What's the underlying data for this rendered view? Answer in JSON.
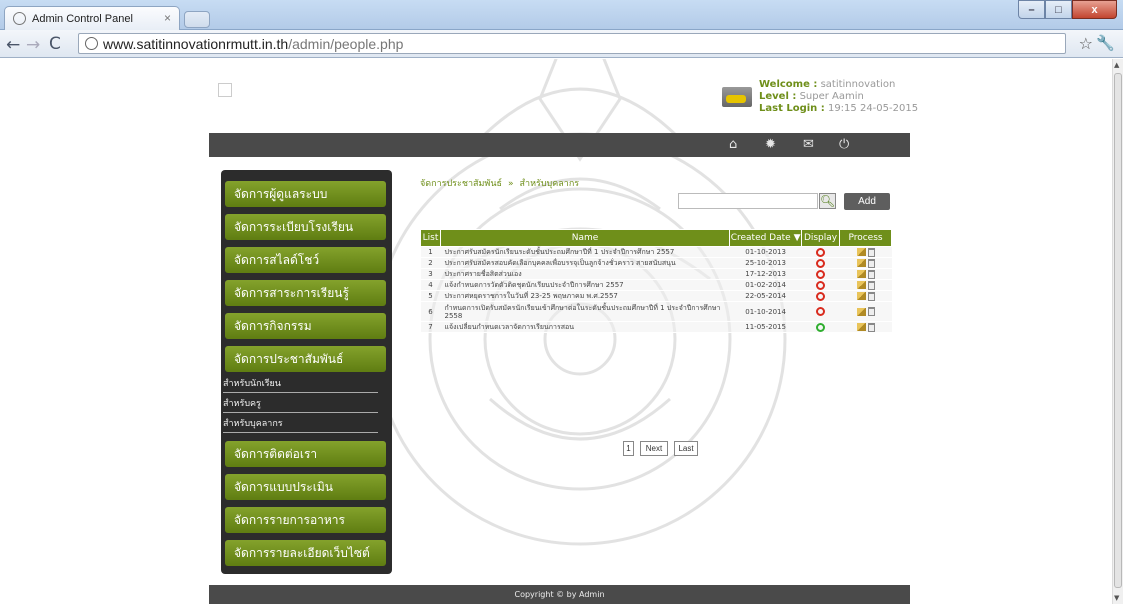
{
  "browser": {
    "tab_title": "Admin Control Panel",
    "tab_close": "×",
    "url_host": "www.satitinnovationrmutt.in.th",
    "url_path": "/admin/people.php",
    "window_buttons": {
      "minimize": "–",
      "maximize": "□",
      "close": "x"
    }
  },
  "user": {
    "welcome_label": "Welcome :",
    "welcome_value": "satitinnovation",
    "level_label": "Level :",
    "level_value": "Super Aamin",
    "login_label": "Last Login :",
    "login_value": "19:15 24-05-2015"
  },
  "topbar_icons": [
    "home-icon",
    "settings-icon",
    "mail-icon",
    "power-icon"
  ],
  "sidebar": {
    "items": [
      "จัดการผู้ดูแลระบบ",
      "จัดการระเบียบโรงเรียน",
      "จัดการสไลด์โชว์",
      "จัดการสาระการเรียนรู้",
      "จัดการกิจกรรม",
      "จัดการประชาสัมพันธ์",
      "จัดการติดต่อเรา",
      "จัดการแบบประเมิน",
      "จัดการรายการอาหาร",
      "จัดการรายละเอียดเว็บไซต์"
    ],
    "subitems": [
      "สำหรับนักเรียน",
      "สำหรับครู",
      "สำหรับบุคลากร"
    ]
  },
  "breadcrumb": {
    "parent": "จัดการประชาสัมพันธ์",
    "sep": "»",
    "current": "สำหรับบุคลากร"
  },
  "search": {
    "placeholder": "",
    "add_label": "Add"
  },
  "table": {
    "headers": {
      "list": "List",
      "name": "Name",
      "created": "Created Date",
      "sort_arrow": "▼",
      "display": "Display",
      "process": "Process"
    },
    "rows": [
      {
        "no": "1",
        "name": "ประกาศรับสมัครนักเรียนระดับชั้นประถมศึกษาปีที่ 1 ประจำปีการศึกษา 2557",
        "date": "01-10-2013",
        "display": "off"
      },
      {
        "no": "2",
        "name": "ประกาศรับสมัครสอบคัดเลือกบุคคลเพื่อบรรจุเป็นลูกจ้างชั่วคราว สายสนับสนุน",
        "date": "25-10-2013",
        "display": "off"
      },
      {
        "no": "3",
        "name": "ประกาศรายชื่อสิตส่วนเอง",
        "date": "17-12-2013",
        "display": "off"
      },
      {
        "no": "4",
        "name": "แจ้งกำหนดการวัดตัวติดชุดนักเรียนประจำปีการศึกษา 2557",
        "date": "01-02-2014",
        "display": "off"
      },
      {
        "no": "5",
        "name": "ประกาศหยุดราชการในวันที่ 23-25 พฤษภาคม พ.ศ.2557",
        "date": "22-05-2014",
        "display": "off"
      },
      {
        "no": "6",
        "name": "กำหนดการเปิดรับสมัครนักเรียนเข้าศึกษาต่อในระดับชั้นประถมศึกษาปีที่ 1 ประจำปีการศึกษา 2558",
        "date": "01-10-2014",
        "display": "off"
      },
      {
        "no": "7",
        "name": "แจ้งเปลี่ยนกำหนดเวลาจัดการเรียนการสอน",
        "date": "11-05-2015",
        "display": "on"
      }
    ]
  },
  "pagination": {
    "page": "1",
    "next": "Next",
    "last": "Last"
  },
  "footer": {
    "text": "Copyright © by Admin"
  },
  "colors": {
    "accent_green": "#6f8f1a",
    "dark_bar": "#4a4a4a",
    "sidebar_bg": "#2c2c2c",
    "display_off": "#d92b1e",
    "display_on": "#2fae2f"
  }
}
